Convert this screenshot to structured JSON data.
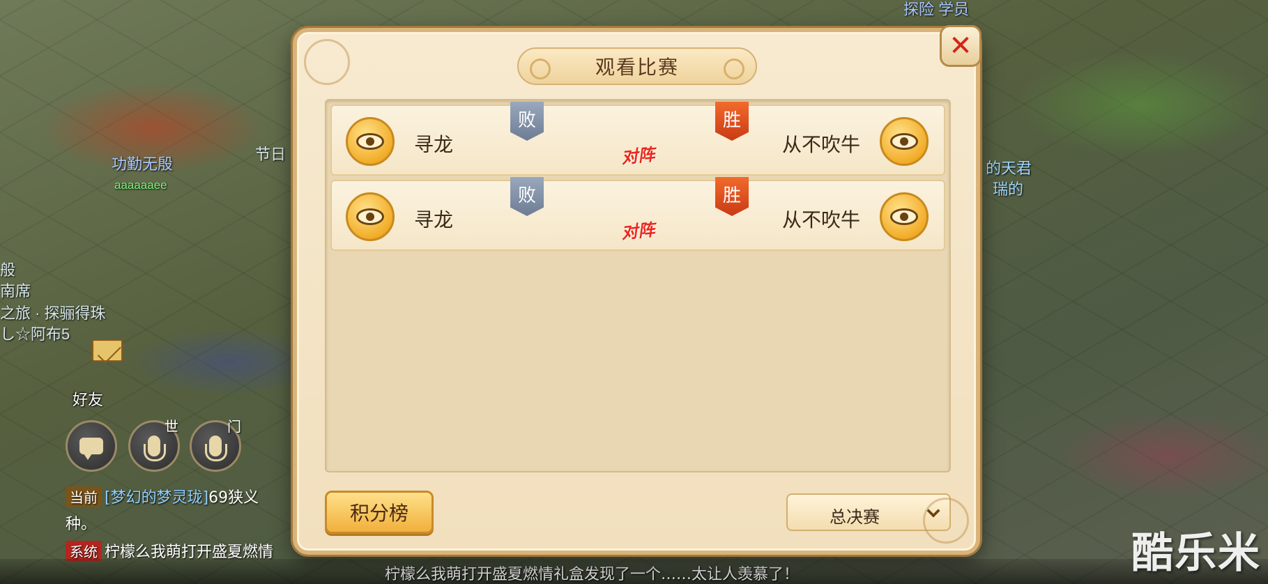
{
  "background": {
    "texts": [
      {
        "id": "top-right-name",
        "text": "探险  学员"
      },
      {
        "id": "left-name-1",
        "text": "功勤无殷"
      },
      {
        "id": "left-name-2",
        "text": "aaaaaaee"
      },
      {
        "id": "left-festival",
        "text": "节日"
      },
      {
        "id": "right-name-1",
        "text": "的天君"
      },
      {
        "id": "right-name-2",
        "text": "瑞的"
      },
      {
        "id": "left-name-3",
        "text": "般"
      },
      {
        "id": "left-name-4",
        "text": "南席"
      },
      {
        "id": "left-name-5",
        "text": "之旅 · 探骊得珠"
      },
      {
        "id": "left-name-6",
        "text": "し☆阿布5"
      }
    ]
  },
  "chat": {
    "friends_label": "好友",
    "channel_world": "世",
    "channel_sect": "门",
    "current_tag": "当前",
    "current_name": "[梦幻的梦灵珑]",
    "current_msg": "69狭义",
    "current_msg_cont": "种。",
    "system_tag": "系统",
    "system_msg": "柠檬么我萌打开盛夏燃情",
    "ticker": "柠檬么我萌打开盛夏燃情礼盒发现了一个……太让人羡慕了！"
  },
  "dialog": {
    "title": "观看比赛",
    "close_symbol": "✕",
    "matches": [
      {
        "left_player": "寻龙",
        "right_player": "从不吹牛",
        "left_result": "败",
        "right_result": "胜",
        "vs_label": "对阵"
      },
      {
        "left_player": "寻龙",
        "right_player": "从不吹牛",
        "left_result": "败",
        "right_result": "胜",
        "vs_label": "对阵"
      }
    ],
    "rank_button": "积分榜",
    "stage_select": "总决赛"
  },
  "watermark": "酷乐米",
  "colors": {
    "win": "#d9401a",
    "lose": "#7f8da3",
    "accent": "#f1b03c",
    "close": "#d6221a"
  },
  "icons": [
    "eye-icon",
    "close-icon",
    "chevron-down-icon",
    "mail-icon",
    "chat-bubble-icon",
    "microphone-icon"
  ]
}
